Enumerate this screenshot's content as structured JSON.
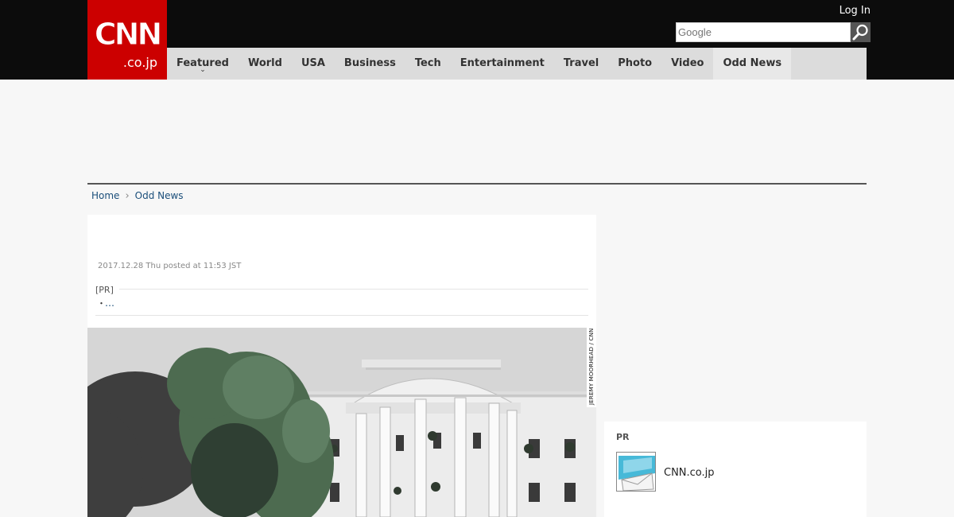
{
  "header": {
    "logo_main": "CNN",
    "logo_sub": ".co.jp",
    "login_label": "Log In",
    "search": {
      "placeholder": "Google",
      "value": ""
    }
  },
  "nav": {
    "items": [
      {
        "label": "Featured"
      },
      {
        "label": "World"
      },
      {
        "label": "USA"
      },
      {
        "label": "Business"
      },
      {
        "label": "Tech"
      },
      {
        "label": "Entertainment"
      },
      {
        "label": "Travel"
      },
      {
        "label": "Photo"
      },
      {
        "label": "Video"
      },
      {
        "label": "Odd News"
      }
    ],
    "featured_chevron": "⌄"
  },
  "breadcrumb": {
    "home": "Home",
    "separator": "›",
    "current": "Odd News"
  },
  "article": {
    "date": "2017.12.28 Thu posted at 11:53 JST",
    "pr_label": "[PR]",
    "pr_bullet": "・",
    "pr_link": "…",
    "photo_credit": "JEREMY MOORHEAD / CNN"
  },
  "sidebar": {
    "pr_label": "PR",
    "pr_item_title": "CNN.co.jp"
  },
  "colors": {
    "brand_red": "#cc0000",
    "header_bg": "#0c0c0c",
    "nav_bg": "#dcdcdc",
    "link": "#1a4e7a"
  }
}
